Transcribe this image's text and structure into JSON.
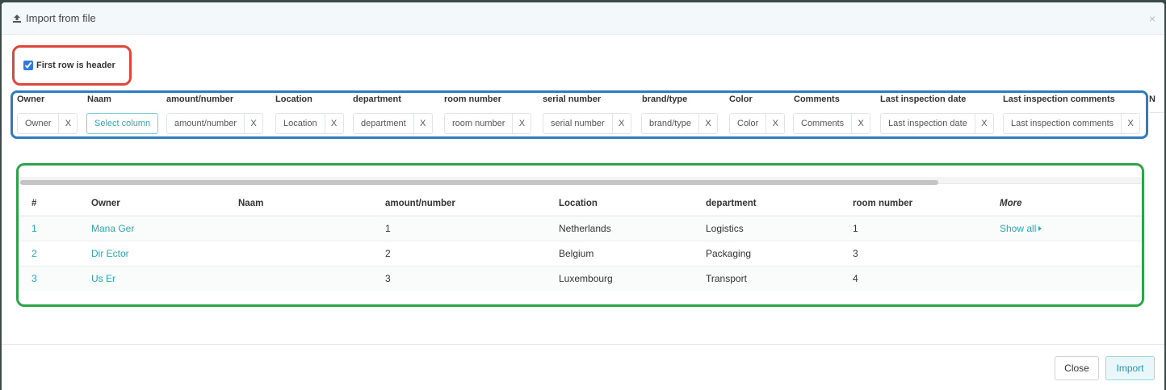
{
  "modal": {
    "title": "Import from file",
    "close_label": "×"
  },
  "header_option": {
    "label": "First row is header",
    "checked": true
  },
  "mapping": {
    "columns": [
      {
        "header": "Owner",
        "value": "Owner",
        "remove": "X"
      },
      {
        "header": "Naam",
        "value": "Select column",
        "remove": ""
      },
      {
        "header": "amount/number",
        "value": "amount/number",
        "remove": "X"
      },
      {
        "header": "Location",
        "value": "Location",
        "remove": "X"
      },
      {
        "header": "department",
        "value": "department",
        "remove": "X"
      },
      {
        "header": "room number",
        "value": "room number",
        "remove": "X"
      },
      {
        "header": "serial number",
        "value": "serial number",
        "remove": "X"
      },
      {
        "header": "brand/type",
        "value": "brand/type",
        "remove": "X"
      },
      {
        "header": "Color",
        "value": "Color",
        "remove": "X"
      },
      {
        "header": "Comments",
        "value": "Comments",
        "remove": "X"
      },
      {
        "header": "Last inspection date",
        "value": "Last inspection date",
        "remove": "X"
      },
      {
        "header": "Last inspection comments",
        "value": "Last inspection comments",
        "remove": "X"
      }
    ],
    "overflow_header": "N"
  },
  "preview": {
    "headers": [
      "#",
      "Owner",
      "Naam",
      "amount/number",
      "Location",
      "department",
      "room number",
      "More"
    ],
    "rows": [
      {
        "num": "1",
        "owner": "Mana Ger",
        "naam": "",
        "amount": "1",
        "location": "Netherlands",
        "department": "Logistics",
        "room": "1",
        "more": "Show all"
      },
      {
        "num": "2",
        "owner": "Dir Ector",
        "naam": "",
        "amount": "2",
        "location": "Belgium",
        "department": "Packaging",
        "room": "3",
        "more": ""
      },
      {
        "num": "3",
        "owner": "Us Er",
        "naam": "",
        "amount": "3",
        "location": "Luxembourg",
        "department": "Transport",
        "room": "4",
        "more": ""
      }
    ]
  },
  "footer": {
    "close_label": "Close",
    "import_label": "Import"
  },
  "colors": {
    "highlight_red": "#e0473a",
    "highlight_blue": "#2f7bbf",
    "highlight_green": "#2fa24c",
    "link": "#2aa9b6"
  }
}
